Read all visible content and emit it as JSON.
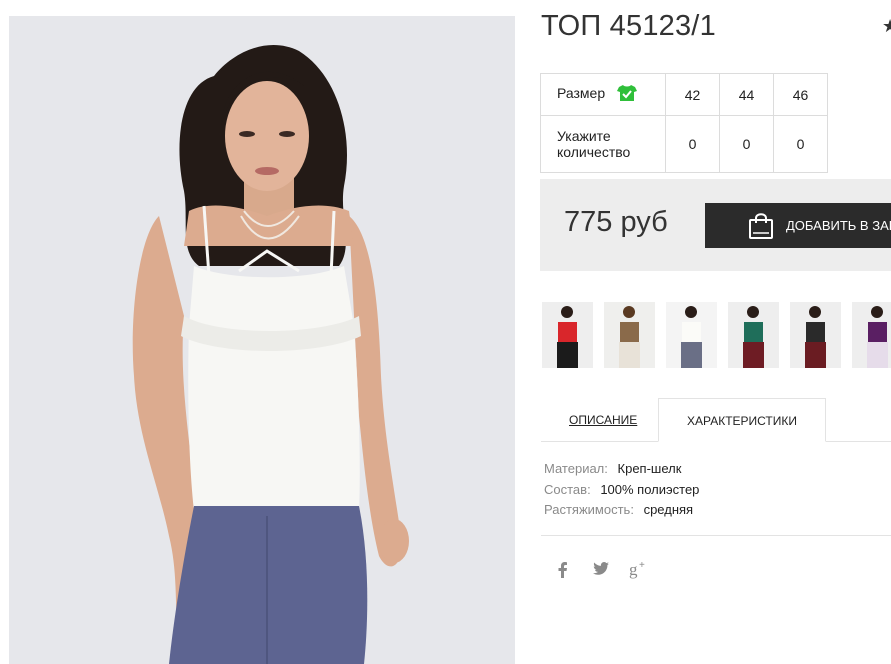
{
  "product": {
    "title": "ТОП 45123/1",
    "favorite_icon": "star-icon"
  },
  "size_table": {
    "size_label": "Размер",
    "size_icon": "shirt-check-icon",
    "sizes": [
      "42",
      "44",
      "46"
    ],
    "qty_label_line1": "Укажите",
    "qty_label_line2": "количество",
    "quantities": [
      "0",
      "0",
      "0"
    ]
  },
  "purchase": {
    "price": "775 руб",
    "add_to_cart_label": "ДОБАВИТЬ В ЗАКАЗ",
    "button_icon": "shopping-bag-icon"
  },
  "thumbnails": [
    {
      "name": "red-top-thumbnail",
      "top_color": "#d9262b",
      "bottom_color": "#1b1b1b"
    },
    {
      "name": "leopard-top-thumbnail",
      "top_color": "#8a6a4a",
      "bottom_color": "#e8e2d8"
    },
    {
      "name": "white-top-thumbnail",
      "top_color": "#f5f5f0",
      "bottom_color": "#6a6f86"
    },
    {
      "name": "green-top-thumbnail",
      "top_color": "#1f6e5a",
      "bottom_color": "#6e1c24"
    },
    {
      "name": "black-top-thumbnail",
      "top_color": "#2a2a2a",
      "bottom_color": "#6a1c22"
    },
    {
      "name": "purple-top-thumbnail",
      "top_color": "#5a1f63",
      "bottom_color": "#e6dcea"
    }
  ],
  "tabs": {
    "description": "ОПИСАНИЕ",
    "characteristics": "ХАРАКТЕРИСТИКИ"
  },
  "specs": [
    {
      "key": "Материал:",
      "value": "Креп-шелк"
    },
    {
      "key": "Состав:",
      "value": "100% полиэстер"
    },
    {
      "key": "Растяжимость:",
      "value": "средняя"
    }
  ],
  "social": [
    "facebook-icon",
    "twitter-icon",
    "google-plus-icon"
  ],
  "colors": {
    "accent_dark": "#2b2b2b",
    "price_band": "#ededed",
    "size_icon_green": "#2fbf3a"
  }
}
